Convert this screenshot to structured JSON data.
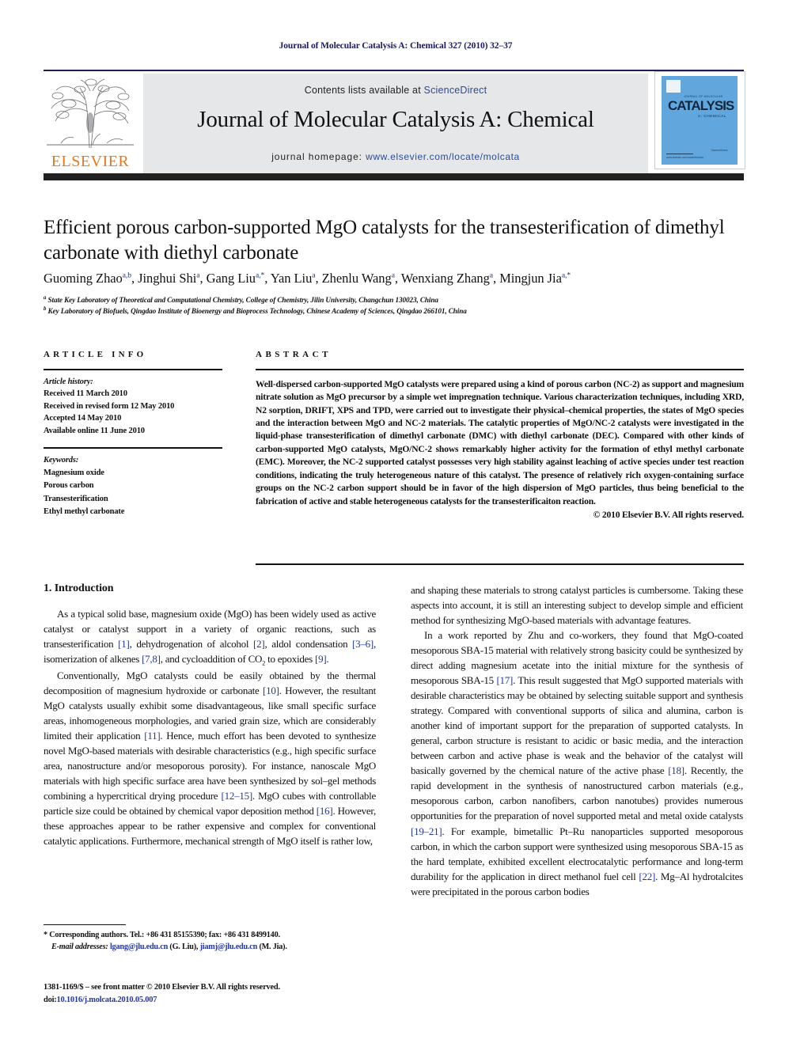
{
  "running_head": "Journal of Molecular Catalysis A: Chemical 327 (2010) 32–37",
  "masthead": {
    "contents_prefix": "Contents lists available at ",
    "contents_link": "ScienceDirect",
    "journal_title": "Journal of Molecular Catalysis A: Chemical",
    "homepage_prefix": "journal homepage: ",
    "homepage_url": "www.elsevier.com/locate/molcata",
    "publisher": "ELSEVIER",
    "cover": {
      "brand": "CATALYSIS",
      "top_tag": "JOURNAL OF MOLECULAR",
      "subtitle": "A: CHEMICAL",
      "bottom_left": "www.elsevier.com/locate/molcata",
      "bottom_right": "ScienceDirect"
    }
  },
  "article": {
    "title": "Efficient porous carbon-supported MgO catalysts for the transesterification of dimethyl carbonate with diethyl carbonate",
    "authors_html": "Guoming Zhao<sup>a,b</sup>, Jinghui Shi<sup>a</sup>, Gang Liu<sup>a,*</sup>, Yan Liu<sup>a</sup>, Zhenlu Wang<sup>a</sup>, Wenxiang Zhang<sup>a</sup>, Mingjun Jia<sup>a,*</sup>",
    "affiliation_a": "State Key Laboratory of Theoretical and Computational Chemistry, College of Chemistry, Jilin University, Changchun 130023, China",
    "affiliation_b": "Key Laboratory of Biofuels, Qingdao Institute of Bioenergy and Bioprocess Technology, Chinese Academy of Sciences, Qingdao 266101, China"
  },
  "info": {
    "heading": "ARTICLE INFO",
    "history_label": "Article history:",
    "history": [
      "Received 11 March 2010",
      "Received in revised form 12 May 2010",
      "Accepted 14 May 2010",
      "Available online 11 June 2010"
    ],
    "keywords_label": "Keywords:",
    "keywords": [
      "Magnesium oxide",
      "Porous carbon",
      "Transesterification",
      "Ethyl methyl carbonate"
    ]
  },
  "abstract": {
    "heading": "ABSTRACT",
    "text": "Well-dispersed carbon-supported MgO catalysts were prepared using a kind of porous carbon (NC-2) as support and magnesium nitrate solution as MgO precursor by a simple wet impregnation technique. Various characterization techniques, including XRD, N2 sorption, DRIFT, XPS and TPD, were carried out to investigate their physical–chemical properties, the states of MgO species and the interaction between MgO and NC-2 materials. The catalytic properties of MgO/NC-2 catalysts were investigated in the liquid-phase transesterification of dimethyl carbonate (DMC) with diethyl carbonate (DEC). Compared with other kinds of carbon-supported MgO catalysts, MgO/NC-2 shows remarkably higher activity for the formation of ethyl methyl carbonate (EMC). Moreover, the NC-2 supported catalyst possesses very high stability against leaching of active species under test reaction conditions, indicating the truly heterogeneous nature of this catalyst. The presence of relatively rich oxygen-containing surface groups on the NC-2 carbon support should be in favor of the high dispersion of MgO particles, thus being beneficial to the fabrication of active and stable heterogeneous catalysts for the transesterificaiton reaction.",
    "copyright": "© 2010 Elsevier B.V. All rights reserved."
  },
  "body": {
    "section_heading": "1. Introduction",
    "left_paragraphs": [
      "As a typical solid base, magnesium oxide (MgO) has been widely used as active catalyst or catalyst support in a variety of organic reactions, such as transesterification [1], dehydrogenation of alcohol [2], aldol condensation [3–6], isomerization of alkenes [7,8], and cycloaddition of CO2 to epoxides [9].",
      "Conventionally, MgO catalysts could be easily obtained by the thermal decomposition of magnesium hydroxide or carbonate [10]. However, the resultant MgO catalysts usually exhibit some disadvantageous, like small specific surface areas, inhomogeneous morphologies, and varied grain size, which are considerably limited their application [11]. Hence, much effort has been devoted to synthesize novel MgO-based materials with desirable characteristics (e.g., high specific surface area, nanostructure and/or mesoporous porosity). For instance, nanoscale MgO materials with high specific surface area have been synthesized by sol–gel methods combining a hypercritical drying procedure [12–15]. MgO cubes with controllable particle size could be obtained by chemical vapor deposition method [16]. However, these approaches appear to be rather expensive and complex for conventional catalytic applications. Furthermore, mechanical strength of MgO itself is rather low,"
    ],
    "right_paragraphs": [
      "and shaping these materials to strong catalyst particles is cumbersome. Taking these aspects into account, it is still an interesting subject to develop simple and efficient method for synthesizing MgO-based materials with advantage features.",
      "In a work reported by Zhu and co-workers, they found that MgO-coated mesoporous SBA-15 material with relatively strong basicity could be synthesized by direct adding magnesium acetate into the initial mixture for the synthesis of mesoporous SBA-15 [17]. This result suggested that MgO supported materials with desirable characteristics may be obtained by selecting suitable support and synthesis strategy. Compared with conventional supports of silica and alumina, carbon is another kind of important support for the preparation of supported catalysts. In general, carbon structure is resistant to acidic or basic media, and the interaction between carbon and active phase is weak and the behavior of the catalyst will basically governed by the chemical nature of the active phase [18]. Recently, the rapid development in the synthesis of nanostructured carbon materials (e.g., mesoporous carbon, carbon nanofibers, carbon nanotubes) provides numerous opportunities for the preparation of novel supported metal and metal oxide catalysts [19–21]. For example, bimetallic Pt–Ru nanoparticles supported mesoporous carbon, in which the carbon support were synthesized using mesoporous SBA-15 as the hard template, exhibited excellent electrocatalytic performance and long-term durability for the application in direct methanol fuel cell [22]. Mg–Al hydrotalcites were precipitated in the porous carbon bodies"
    ]
  },
  "footnote": {
    "corresponding": "* Corresponding authors. Tel.: +86 431 85155390; fax: +86 431 8499140.",
    "email_label": "E-mail addresses:",
    "email1": "lgang@jlu.edu.cn",
    "email1_name": "(G. Liu),",
    "email2": "jiamj@jlu.edu.cn",
    "email2_name": "(M. Jia)."
  },
  "footer": {
    "issn_line": "1381-1169/$ – see front matter © 2010 Elsevier B.V. All rights reserved.",
    "doi_label": "doi:",
    "doi_value": "10.1016/j.molcata.2010.05.007"
  },
  "colors": {
    "link": "#2a4b9b",
    "reference": "#2237a0",
    "elsevier_orange": "#e77817",
    "band_gray": "#e6e7e8",
    "rule_dark": "#221f1f",
    "cover_blue": "#61a7dd"
  }
}
